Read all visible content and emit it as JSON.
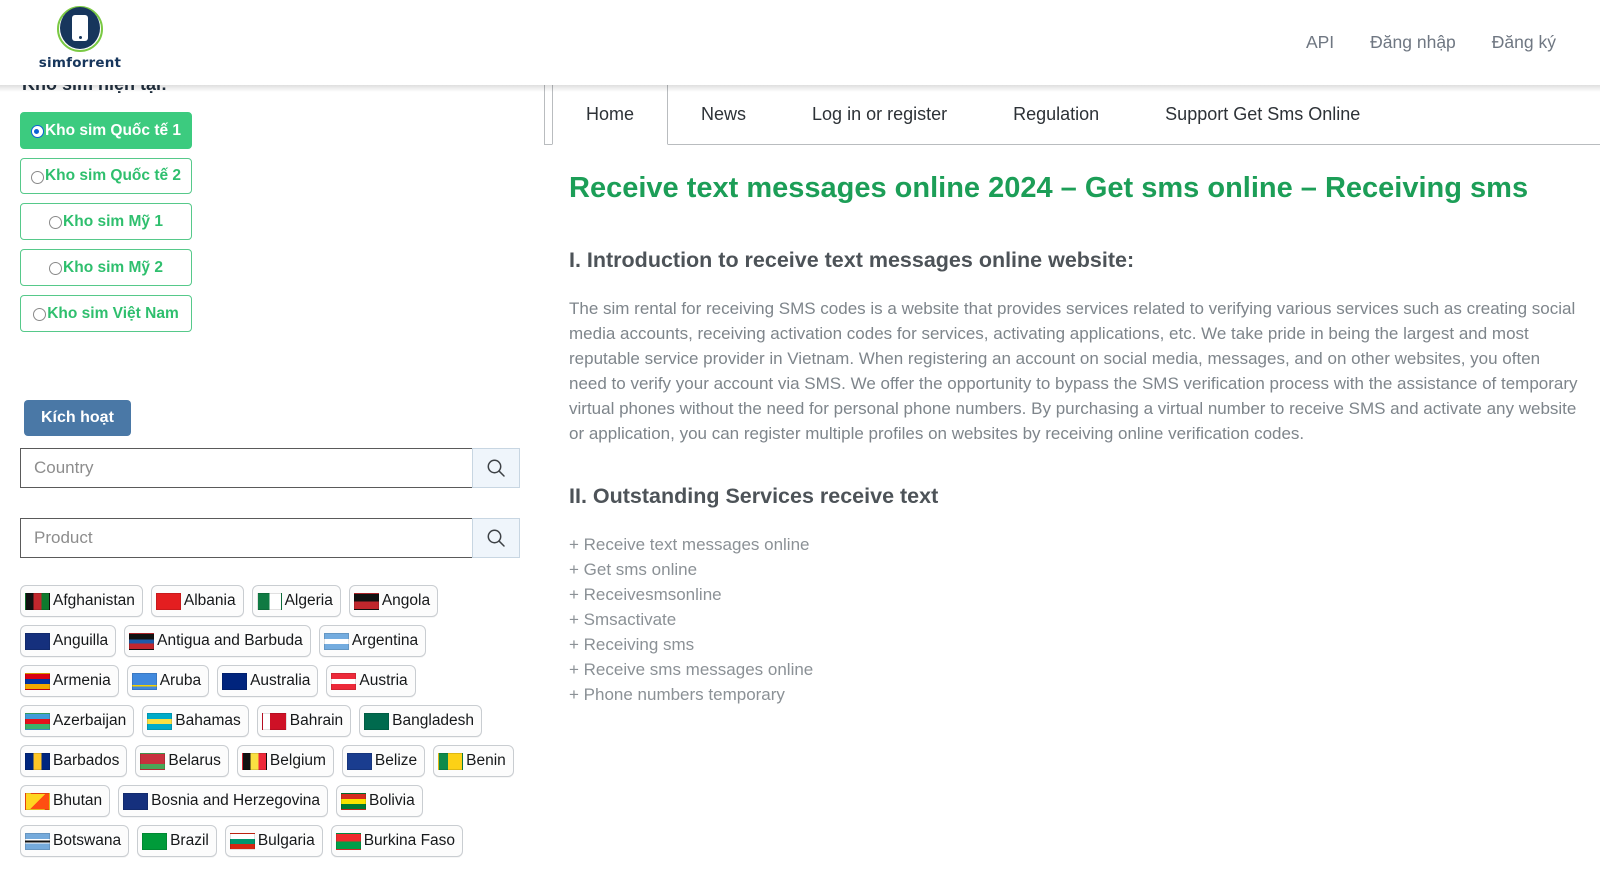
{
  "brand": {
    "name": "simforrent",
    "logo_icon": "phone-in-circle-icon"
  },
  "header": {
    "nav": [
      {
        "label": "API"
      },
      {
        "label": "Đăng nhập"
      },
      {
        "label": "Đăng ký"
      }
    ]
  },
  "sidebar": {
    "title": "Kho sim hiện tại:",
    "store_options": [
      {
        "label": "Kho sim Quốc tế 1",
        "selected": true,
        "two_line": false
      },
      {
        "label": "Kho sim Quốc tế 2",
        "selected": false,
        "two_line": true
      },
      {
        "label": "Kho sim Mỹ 1",
        "selected": false,
        "two_line": false
      },
      {
        "label": "Kho sim Mỹ 2",
        "selected": false,
        "two_line": false
      },
      {
        "label": "Kho sim Việt Nam",
        "selected": false,
        "two_line": false
      }
    ],
    "activate_button": "Kích hoạt",
    "country_search": {
      "value": "",
      "placeholder": "Country",
      "icon": "search-icon"
    },
    "product_search": {
      "value": "",
      "placeholder": "Product",
      "icon": "search-icon"
    },
    "countries": [
      {
        "name": "Afghanistan",
        "flag": "af"
      },
      {
        "name": "Albania",
        "flag": "al"
      },
      {
        "name": "Algeria",
        "flag": "dz"
      },
      {
        "name": "Angola",
        "flag": "ao"
      },
      {
        "name": "Anguilla",
        "flag": "ai"
      },
      {
        "name": "Antigua and Barbuda",
        "flag": "ag"
      },
      {
        "name": "Argentina",
        "flag": "ar"
      },
      {
        "name": "Armenia",
        "flag": "am"
      },
      {
        "name": "Aruba",
        "flag": "aw"
      },
      {
        "name": "Australia",
        "flag": "au"
      },
      {
        "name": "Austria",
        "flag": "at"
      },
      {
        "name": "Azerbaijan",
        "flag": "az"
      },
      {
        "name": "Bahamas",
        "flag": "bs"
      },
      {
        "name": "Bahrain",
        "flag": "bh"
      },
      {
        "name": "Bangladesh",
        "flag": "bd"
      },
      {
        "name": "Barbados",
        "flag": "bb"
      },
      {
        "name": "Belarus",
        "flag": "by"
      },
      {
        "name": "Belgium",
        "flag": "be"
      },
      {
        "name": "Belize",
        "flag": "bz"
      },
      {
        "name": "Benin",
        "flag": "bj"
      },
      {
        "name": "Bhutan",
        "flag": "bt"
      },
      {
        "name": "Bosnia and Herzegovina",
        "flag": "ba"
      },
      {
        "name": "Bolivia",
        "flag": "bo"
      },
      {
        "name": "Botswana",
        "flag": "bw"
      },
      {
        "name": "Brazil",
        "flag": "br"
      },
      {
        "name": "Bulgaria",
        "flag": "bg"
      },
      {
        "name": "Burkina Faso",
        "flag": "bf"
      }
    ]
  },
  "main": {
    "tabs": [
      {
        "label": "Home",
        "active": true
      },
      {
        "label": "News",
        "active": false
      },
      {
        "label": "Log in or register",
        "active": false
      },
      {
        "label": "Regulation",
        "active": false
      },
      {
        "label": "Support Get Sms Online",
        "active": false
      }
    ],
    "article": {
      "title": "Receive text messages online 2024 – Get sms online – Receiving sms",
      "section1_heading": "I. Introduction to receive text messages online website:",
      "section1_body": "The sim rental for receiving SMS codes is a website that provides services related to verifying various services such as creating social media accounts, receiving activation codes for services, activating applications, etc. We take pride in being the largest and most reputable service provider in Vietnam. When registering an account on social media, messages, and on other websites, you often need to verify your account via SMS. We offer the opportunity to bypass the SMS verification process with the assistance of temporary virtual phones without the need for personal phone numbers. By purchasing a virtual number to receive SMS and activate any website or application, you can register multiple profiles on websites by receiving online verification codes.",
      "section2_heading": "II. Outstanding Services receive text",
      "services": [
        "+ Receive text messages online",
        "+ Get sms online",
        "+ Receivesmsonline",
        "+ Smsactivate",
        "+ Receiving sms",
        "+ Receive sms messages online",
        "+ Phone numbers temporary"
      ]
    }
  },
  "colors": {
    "brand_navy": "#17365c",
    "brand_green": "#7ac943",
    "accent_green": "#3ccb7f",
    "heading_green": "#1c9e57",
    "activate_blue": "#4a78a6",
    "body_gray": "#7e858b"
  }
}
